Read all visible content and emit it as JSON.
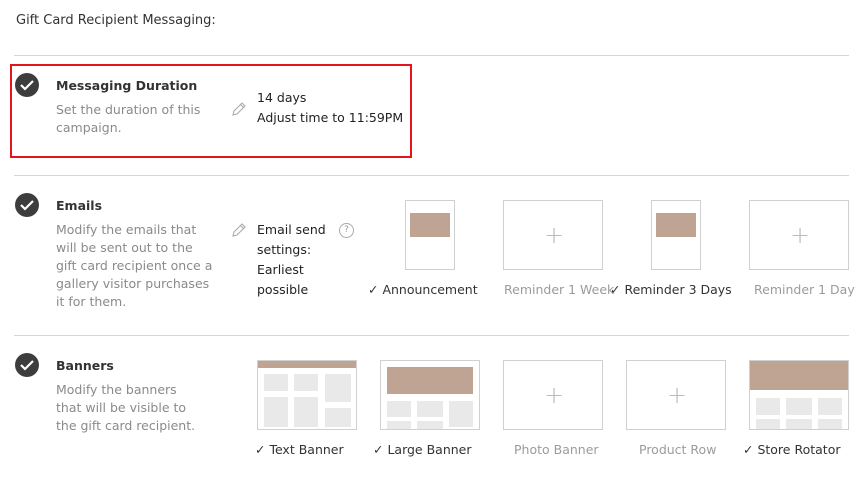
{
  "page": {
    "heading": "Gift Card Recipient Messaging:"
  },
  "colors": {
    "accent_thumb": "#bfa393",
    "highlight_border": "#e3141b",
    "check_bg": "#3d3d3d"
  },
  "sections": {
    "duration": {
      "title": "Messaging Duration",
      "description": "Set the duration of this campaign.",
      "value_line1": "14 days",
      "value_line2": "Adjust time to 11:59PM"
    },
    "emails": {
      "title": "Emails",
      "description": "Modify the emails that will be sent out to the gift card recipient once a gallery visitor purchases it for them.",
      "settings": "Email send settings: Earliest possible",
      "help_icon": "?",
      "items": [
        {
          "label": "Announcement",
          "enabled": true
        },
        {
          "label": "Reminder 1 Week",
          "enabled": false
        },
        {
          "label": "Reminder 3 Days",
          "enabled": true
        },
        {
          "label": "Reminder 1 Day",
          "enabled": false
        }
      ]
    },
    "banners": {
      "title": "Banners",
      "description": "Modify the banners that will be visible to the gift card recipient.",
      "items": [
        {
          "label": "Text Banner",
          "enabled": true
        },
        {
          "label": "Large Banner",
          "enabled": true
        },
        {
          "label": "Photo Banner",
          "enabled": false
        },
        {
          "label": "Product Row",
          "enabled": false
        },
        {
          "label": "Store Rotator",
          "enabled": true
        }
      ]
    }
  },
  "icons": {
    "check": "check-icon",
    "pencil": "pencil-icon",
    "plus": "plus-icon",
    "help": "help-icon"
  }
}
